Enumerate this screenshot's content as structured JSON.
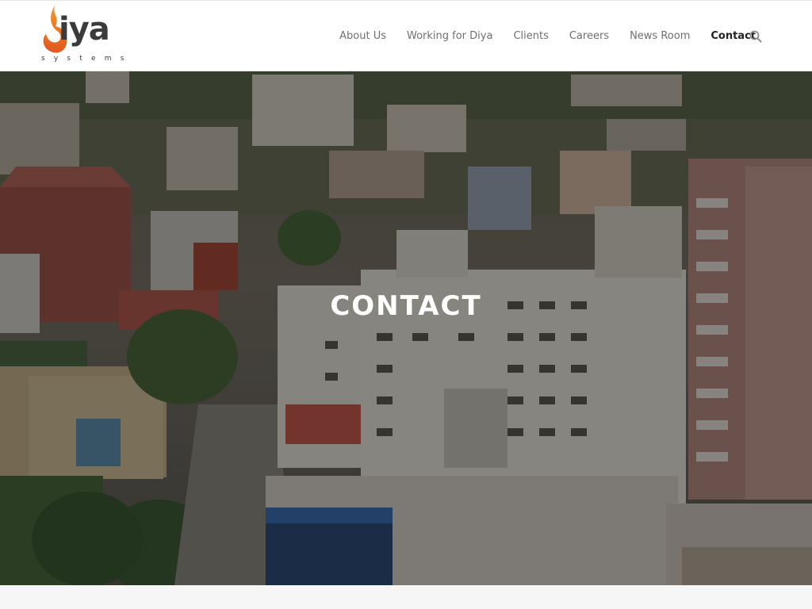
{
  "brand": {
    "name": "iya",
    "tagline": "systems",
    "accent": "#e4572e"
  },
  "nav": {
    "items": [
      {
        "label": "About Us"
      },
      {
        "label": "Working for Diya"
      },
      {
        "label": "Clients"
      },
      {
        "label": "Careers"
      },
      {
        "label": "News Room"
      },
      {
        "label": "Contact",
        "active": true
      }
    ],
    "search_icon": "search-icon"
  },
  "hero": {
    "title": "CONTACT"
  }
}
